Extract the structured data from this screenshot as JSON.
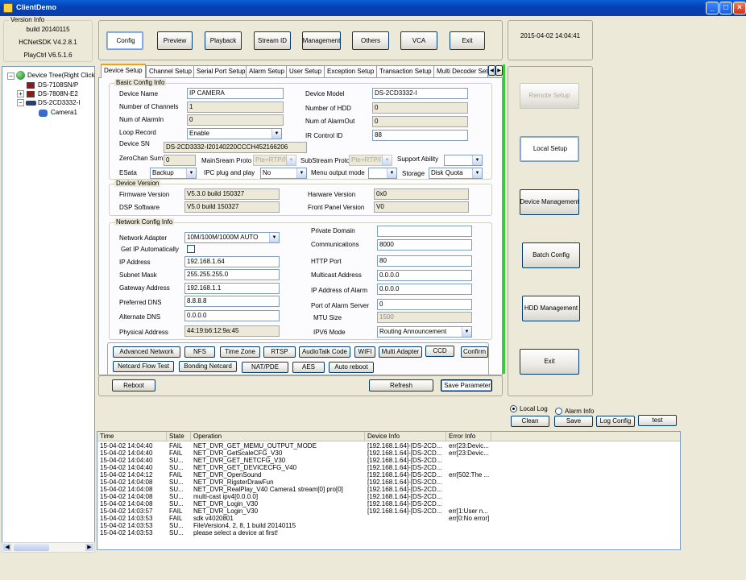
{
  "window": {
    "title": "ClientDemo",
    "min_glyph": "_",
    "max_glyph": "□",
    "close_glyph": "×"
  },
  "version_info": {
    "title": "Version Info",
    "build": "build 20140115",
    "sdk": "HCNetSDK V4.2.8.1",
    "playctrl": "PlayCtrl V6.5.1.6"
  },
  "toolbar": {
    "buttons": [
      "Config",
      "Preview",
      "Playback",
      "Stream ID",
      "Management",
      "Others",
      "VCA",
      "Exit"
    ]
  },
  "datetime": "2015-04-02  14:04:41",
  "tree": {
    "root": "Device Tree(Right Click",
    "nodes": [
      "DS-7108SN/P",
      "DS-7808N-E2",
      "DS-2CD3332-I"
    ],
    "camera": "Camera1"
  },
  "tabs": [
    "Device Setup",
    "Channel Setup",
    "Serial Port Setup",
    "Alarm Setup",
    "User Setup",
    "Exception Setup",
    "Transaction Setup",
    "Multi Decoder Set"
  ],
  "basic": {
    "title": "Basic Config Info",
    "device_name_label": "Device Name",
    "device_name": "IP CAMERA",
    "num_channels_label": "Number of Channels",
    "num_channels": "1",
    "num_alarmin_label": "Num of AlarmIn",
    "num_alarmin": "0",
    "loop_record_label": "Loop Record",
    "loop_record": "Enable",
    "device_sn_label": "Device SN",
    "device_sn": "DS-2CD3332-I20140220CCCH452166206",
    "zerochan_label": "ZeroChan Sum",
    "zerochan": "0",
    "mainstream_label": "MainSream Proto",
    "mainstream": "Pte+RTP/F",
    "substream_label": "SubStream Proto",
    "substream": "Pte+RTP/I",
    "support_label": "Support Ability",
    "support": "",
    "esata_label": "ESata",
    "esata": "Backup",
    "ipc_label": "IPC plug and play",
    "ipc": "No",
    "menu_output_label": "Menu output mode",
    "menu_output": "",
    "storage_label": "Storage",
    "storage": "Disk Quota",
    "device_model_label": "Device Model",
    "device_model": "DS-2CD3332-I",
    "num_hdd_label": "Number of HDD",
    "num_hdd": "0",
    "num_alarmout_label": "Num of AlarmOut",
    "num_alarmout": "0",
    "ir_label": "IR Control ID",
    "ir": "88"
  },
  "version": {
    "title": "Device Version",
    "fw_label": "Firmware Version",
    "fw": "V5.3.0 build 150327",
    "dsp_label": "DSP Software",
    "dsp": "V5.0 build 150327",
    "hw_label": "Harware Version",
    "hw": "0x0",
    "fp_label": "Front Panel Version",
    "fp": "V0"
  },
  "network": {
    "title": "Network Config Info",
    "adapter_label": "Network Adapter",
    "adapter": "10M/100M/1000M AUTO",
    "dhcp_label": "Get IP Automatically",
    "ip_label": "IP Address",
    "ip": "192.168.1.64",
    "mask_label": "Subnet Mask",
    "mask": "255.255.255.0",
    "gw_label": "Gateway Address",
    "gw": "192.168.1.1",
    "dns1_label": "Preferred DNS",
    "dns1": "8.8.8.8",
    "dns2_label": "Alternate DNS",
    "dns2": "0.0.0.0",
    "mac_label": "Physical Address",
    "mac": "44:19:b6:12:9a:45",
    "domain_label": "Private Domain",
    "domain": "",
    "comm_label": "Communications",
    "comm": "8000",
    "http_label": "HTTP Port",
    "http": "80",
    "mcast_label": "Multicast Address",
    "mcast": "0.0.0.0",
    "alarm_ip_label": "IP Address of Alarm",
    "alarm_ip": "0.0.0.0",
    "alarm_port_label": "Port of Alarm Server",
    "alarm_port": "0",
    "mtu_label": "MTU Size",
    "mtu": "1500",
    "ipv6_label": "IPV6 Mode",
    "ipv6": "Routing Announcement"
  },
  "net_buttons_row1": [
    "Advanced Network",
    "NFS",
    "Time Zone",
    "RTSP",
    "AudioTalk Code",
    "WIFI",
    "Multi Adapter",
    "CCD",
    "Confirm"
  ],
  "net_buttons_row2": [
    "Netcard Flow Test",
    "Bonding Netcard",
    "NAT/PDE",
    "AES",
    "Auto reboot"
  ],
  "bottom": {
    "reboot": "Reboot",
    "refresh": "Refresh",
    "save": "Save Parameter"
  },
  "right_menu": [
    "Remote Setup",
    "Local Setup",
    "Device Management",
    "Batch Config",
    "HDD Management",
    "Exit"
  ],
  "log_controls": {
    "local_log": "Local Log",
    "alarm_info": "Alarm Info",
    "clean": "Clean",
    "save": "Save",
    "log_config": "Log Config",
    "test": "test"
  },
  "log": {
    "headers": [
      "Time",
      "State",
      "Operation",
      "Device Info",
      "Error Info"
    ],
    "rows": [
      [
        "15-04-02 14:04:40",
        "FAIL",
        "NET_DVR_GET_MEMU_OUTPUT_MODE",
        "[192.168.1.64]-[DS-2CD...",
        "err[23:Devic..."
      ],
      [
        "15-04-02 14:04:40",
        "FAIL",
        "NET_DVR_GetScaleCFG_V30",
        "[192.168.1.64]-[DS-2CD...",
        "err[23:Devic..."
      ],
      [
        "15-04-02 14:04:40",
        "SU...",
        "NET_DVR_GET_NETCFG_V30",
        "[192.168.1.64]-[DS-2CD...",
        ""
      ],
      [
        "15-04-02 14:04:40",
        "SU...",
        "NET_DVR_GET_DEVICECFG_V40",
        "[192.168.1.64]-[DS-2CD...",
        ""
      ],
      [
        "15-04-02 14:04:12",
        "FAIL",
        "NET_DVR_OpenSound",
        "[192.168.1.64]-[DS-2CD...",
        "err[502:The ..."
      ],
      [
        "15-04-02 14:04:08",
        "SU...",
        "NET_DVR_RigsterDrawFun",
        "[192.168.1.64]-[DS-2CD...",
        ""
      ],
      [
        "15-04-02 14:04:08",
        "SU...",
        "NET_DVR_RealPlay_V40 Camera1 stream[0] pro[0]",
        "[192.168.1.64]-[DS-2CD...",
        ""
      ],
      [
        "15-04-02 14:04:08",
        "SU...",
        "multi-cast ipv4[0.0.0.0]",
        "[192.168.1.64]-[DS-2CD...",
        ""
      ],
      [
        "15-04-02 14:04:08",
        "SU...",
        "NET_DVR_Login_V30",
        "[192.168.1.64]-[DS-2CD...",
        ""
      ],
      [
        "15-04-02 14:03:57",
        "FAIL",
        "NET_DVR_Login_V30",
        "[192.168.1.64]-[DS-2CD...",
        "err[1:User n..."
      ],
      [
        "15-04-02 14:03:53",
        "FAIL",
        "sdk v4020801",
        "",
        "err[0:No error]"
      ],
      [
        "15-04-02 14:03:53",
        "SU...",
        "FileVersion4, 2, 8, 1 build 20140115",
        "",
        ""
      ],
      [
        "15-04-02 14:03:53",
        "SU...",
        "please select a device at first!",
        "",
        ""
      ]
    ]
  }
}
